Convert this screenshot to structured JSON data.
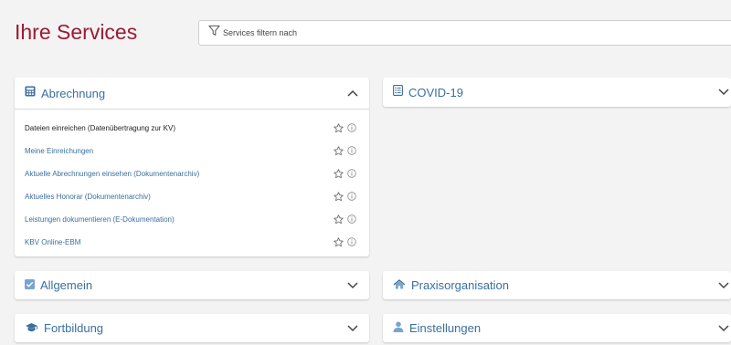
{
  "page": {
    "title": "Ihre Services"
  },
  "filter": {
    "placeholder": "Services filtern nach",
    "value": ""
  },
  "cards": {
    "abrechnung": {
      "label": "Abrechnung",
      "expanded": true,
      "icon": "calculator-icon",
      "items": [
        {
          "label": "Dateien einreichen (Datenübertragung zur KV)"
        },
        {
          "label": "Meine Einreichungen"
        },
        {
          "label": "Aktuelle Abrechnungen einsehen (Dokumentenarchiv)"
        },
        {
          "label": "Aktuelles Honorar (Dokumentenarchiv)"
        },
        {
          "label": "Leistungen dokumentieren (E-Dokumentation)"
        },
        {
          "label": "KBV Online-EBM"
        }
      ]
    },
    "covid": {
      "label": "COVID-19",
      "icon": "list-icon"
    },
    "allgemein": {
      "label": "Allgemein",
      "icon": "checkbox-icon"
    },
    "praxisorganisation": {
      "label": "Praxisorganisation",
      "icon": "house-icon"
    },
    "fortbildung": {
      "label": "Fortbildung",
      "icon": "graduation-cap-icon"
    },
    "einstellungen": {
      "label": "Einstellungen",
      "icon": "user-icon"
    }
  },
  "colors": {
    "title": "#9b1b34",
    "link": "#3a6f9e",
    "background": "#f3f3f3"
  }
}
